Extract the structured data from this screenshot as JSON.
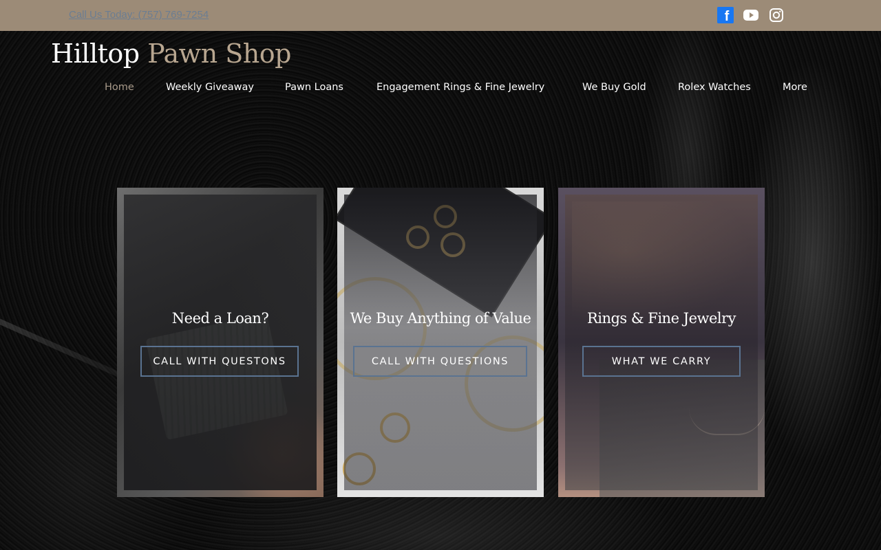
{
  "topbar": {
    "phone": "Call Us Today: (757) 769-7254",
    "social": [
      {
        "name": "facebook-icon",
        "color": "#1877f2"
      },
      {
        "name": "youtube-icon"
      },
      {
        "name": "instagram-icon"
      }
    ]
  },
  "brand": {
    "part1": "Hilltop ",
    "part2": "Pawn Shop"
  },
  "nav": {
    "items": [
      {
        "label": "Home",
        "active": true
      },
      {
        "label": "Weekly Giveaway"
      },
      {
        "label": "Pawn Loans"
      },
      {
        "label": "Engagement Rings & Fine Jewelry"
      },
      {
        "label": "We Buy Gold"
      },
      {
        "label": "Rolex Watches"
      },
      {
        "label": "More"
      }
    ]
  },
  "cards": [
    {
      "title": "Need a Loan?",
      "button": "CALL WITH QUESTONS"
    },
    {
      "title": "We Buy Anything of Value",
      "button": "CALL WITH QUESTIONS"
    },
    {
      "title": "Rings & Fine Jewelry",
      "button": "WHAT WE CARRY"
    }
  ],
  "colors": {
    "topbar": "#9c8b77",
    "brand_accent": "#b8a690",
    "nav_active": "#a89a8a",
    "button_border": "#5a7391",
    "phone_link": "#6b7d92"
  }
}
